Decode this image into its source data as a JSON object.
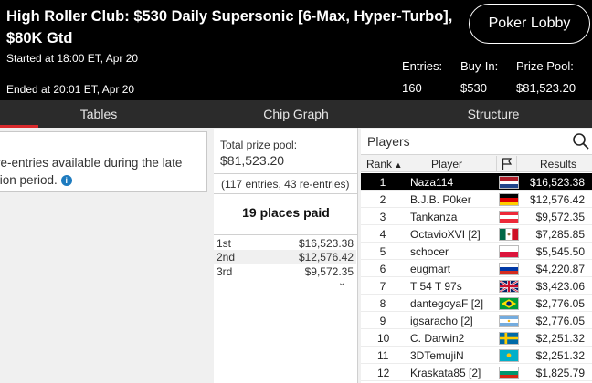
{
  "header": {
    "title": "High Roller Club: $530 Daily Supersonic [6-Max, Hyper-Turbo], $80K Gtd",
    "started": "Started at 18:00 ET, Apr 20",
    "ended": "Ended at 20:01 ET, Apr 20",
    "lobby_button": "Poker Lobby",
    "entries_label": "Entries:",
    "entries_value": "160",
    "buyin_label": "Buy-In:",
    "buyin_value": "$530",
    "prizepool_label": "Prize Pool:",
    "prizepool_value": "$81,523.20"
  },
  "tabs": [
    "Tables",
    "Chip Graph",
    "Structure"
  ],
  "left_panel": {
    "line1": "re-entries available during the late",
    "line2": "tion period."
  },
  "prize_panel": {
    "title": "Total prize pool:",
    "total": "$81,523.20",
    "entries_note": "(117 entries, 43 re-entries)",
    "places_paid": "19 places paid",
    "payouts": [
      {
        "place": "1st",
        "amount": "$16,523.38"
      },
      {
        "place": "2nd",
        "amount": "$12,576.42"
      },
      {
        "place": "3rd",
        "amount": "$9,572.35"
      }
    ]
  },
  "players_panel": {
    "title": "Players",
    "columns": {
      "rank": "Rank",
      "player": "Player",
      "results": "Results"
    },
    "rows": [
      {
        "rank": "1",
        "name": "Naza114",
        "flag": "netherlands-flag",
        "result": "$16,523.38",
        "selected": true
      },
      {
        "rank": "2",
        "name": "B.J.B. P0ker",
        "flag": "germany-flag",
        "result": "$12,576.42"
      },
      {
        "rank": "3",
        "name": "Tankanza",
        "flag": "austria-flag",
        "result": "$9,572.35"
      },
      {
        "rank": "4",
        "name": "OctavioXVI [2]",
        "flag": "mexico-flag",
        "result": "$7,285.85"
      },
      {
        "rank": "5",
        "name": "schocer",
        "flag": "poland-flag",
        "result": "$5,545.50"
      },
      {
        "rank": "6",
        "name": "eugmart",
        "flag": "russia-flag",
        "result": "$4,220.87"
      },
      {
        "rank": "7",
        "name": "T 54 T 97s",
        "flag": "uk-flag",
        "result": "$3,423.06"
      },
      {
        "rank": "8",
        "name": "dantegoyaF [2]",
        "flag": "brazil-flag",
        "result": "$2,776.05"
      },
      {
        "rank": "9",
        "name": "igsaracho [2]",
        "flag": "argentina-flag",
        "result": "$2,776.05"
      },
      {
        "rank": "10",
        "name": "C. Darwin2",
        "flag": "sweden-flag",
        "result": "$2,251.32"
      },
      {
        "rank": "11",
        "name": "3DTemujiN",
        "flag": "kazakhstan-flag",
        "result": "$2,251.32"
      },
      {
        "rank": "12",
        "name": "Kraskata85 [2]",
        "flag": "bulgaria-flag",
        "result": "$1,825.79"
      }
    ]
  }
}
